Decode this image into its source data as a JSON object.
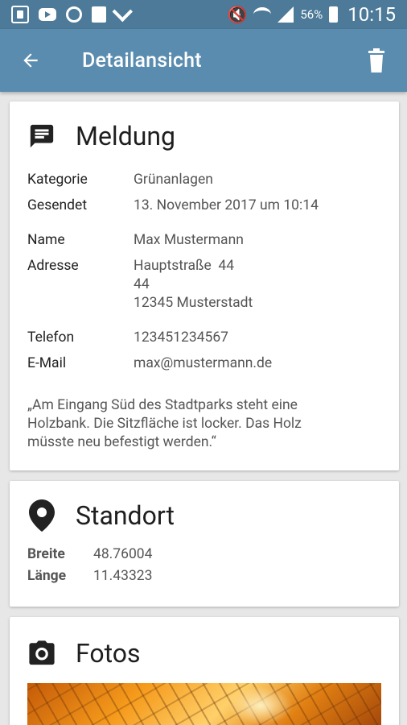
{
  "status_bar": {
    "icons": [
      "app-icon",
      "youtube-icon",
      "sync-icon",
      "document-icon",
      "check-icon"
    ],
    "battery_percent": "56%",
    "time": "10:15"
  },
  "app_bar": {
    "title": "Detailansicht",
    "color": "#5a8caf"
  },
  "meldung": {
    "title": "Meldung",
    "fields": [
      {
        "label": "Kategorie",
        "value": "Grünanlagen"
      },
      {
        "label": "Gesendet",
        "value": "13. November 2017 um 10:14"
      },
      {
        "label": "Name",
        "value": "Max Mustermann"
      },
      {
        "label": "Adresse",
        "value_lines": [
          "Hauptstraße  44",
          "44",
          "12345 Musterstadt"
        ]
      },
      {
        "label": "Telefon",
        "value": "123451234567"
      },
      {
        "label": "E-Mail",
        "value": "max@mustermann.de"
      }
    ],
    "description": "„Am Eingang Süd des Stadtparks steht eine Holzbank. Die Sitzfläche ist locker. Das Holz müsste neu befestigt werden.“"
  },
  "standort": {
    "title": "Standort",
    "lat_label": "Breite",
    "lat_value": "48.76004",
    "lon_label": "Länge",
    "lon_value": "11.43323"
  },
  "fotos": {
    "title": "Fotos"
  }
}
